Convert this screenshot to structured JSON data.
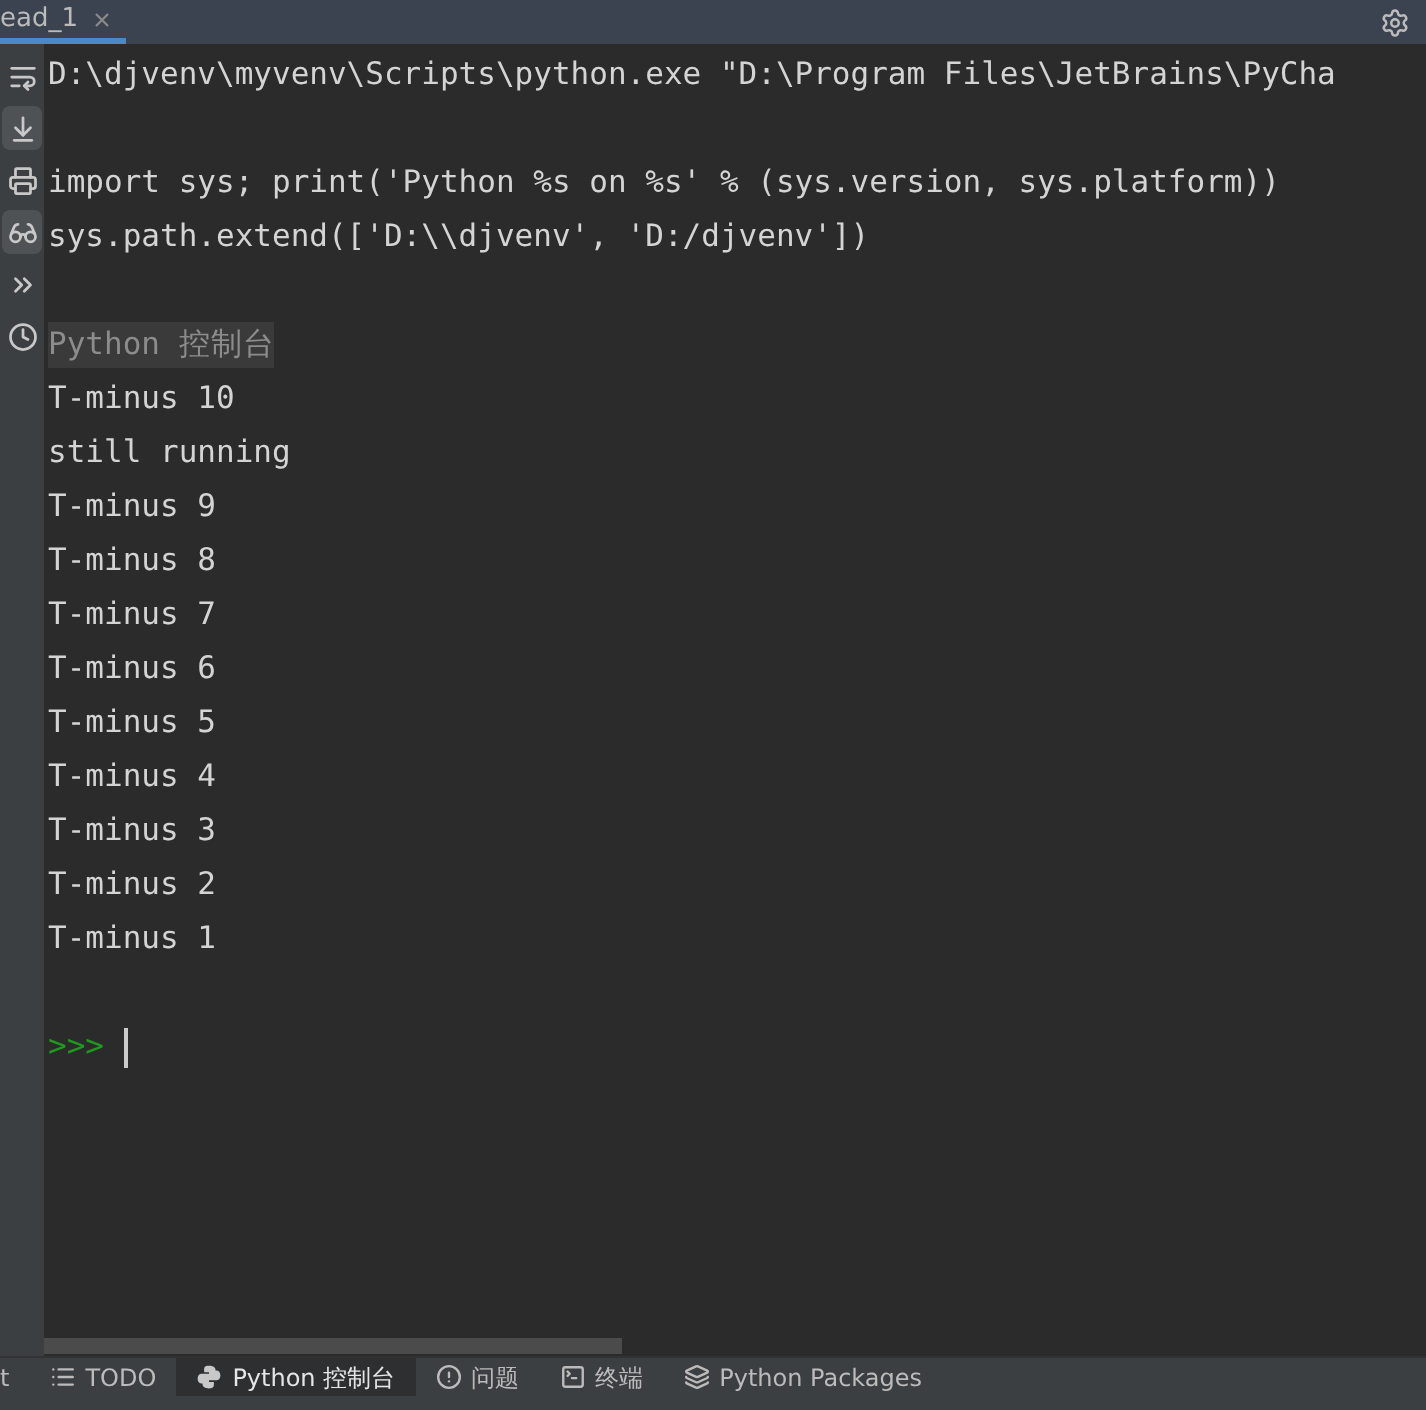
{
  "editor_tabs": [
    {
      "label": "ead_1",
      "selected": true
    }
  ],
  "toolbar": [
    {
      "kind": "wrap",
      "selected": false
    },
    {
      "kind": "scroll-end",
      "selected": true
    },
    {
      "kind": "print",
      "selected": false
    },
    {
      "kind": "glasses",
      "selected": true
    },
    {
      "kind": "run",
      "selected": false
    },
    {
      "kind": "history",
      "selected": false
    }
  ],
  "console": {
    "lines": [
      {
        "kind": "output",
        "text": "D:\\djvenv\\myvenv\\Scripts\\python.exe \"D:\\Program Files\\JetBrains\\PyCha"
      },
      {
        "kind": "blank"
      },
      {
        "kind": "output",
        "text": "import sys; print('Python %s on %s' % (sys.version, sys.platform))"
      },
      {
        "kind": "output",
        "text": "sys.path.extend(['D:\\\\djvenv', 'D:/djvenv'])"
      },
      {
        "kind": "blank"
      },
      {
        "kind": "banner",
        "text": "Python 控制台"
      },
      {
        "kind": "output",
        "text": "T-minus 10"
      },
      {
        "kind": "output",
        "text": "still running"
      },
      {
        "kind": "output",
        "text": "T-minus 9"
      },
      {
        "kind": "output",
        "text": "T-minus 8"
      },
      {
        "kind": "output",
        "text": "T-minus 7"
      },
      {
        "kind": "output",
        "text": "T-minus 6"
      },
      {
        "kind": "output",
        "text": "T-minus 5"
      },
      {
        "kind": "output",
        "text": "T-minus 4"
      },
      {
        "kind": "output",
        "text": "T-minus 3"
      },
      {
        "kind": "output",
        "text": "T-minus 2"
      },
      {
        "kind": "output",
        "text": "T-minus 1"
      },
      {
        "kind": "blank"
      }
    ],
    "prompt": ">>>"
  },
  "tool_tabs": [
    {
      "kind": "none",
      "label": "t",
      "selected": false
    },
    {
      "kind": "list",
      "label": "TODO",
      "selected": false
    },
    {
      "kind": "python",
      "label": "Python 控制台",
      "selected": true
    },
    {
      "kind": "problem",
      "label": "问题",
      "selected": false
    },
    {
      "kind": "terminal",
      "label": "终端",
      "selected": false
    },
    {
      "kind": "layers",
      "label": "Python Packages",
      "selected": false
    }
  ]
}
